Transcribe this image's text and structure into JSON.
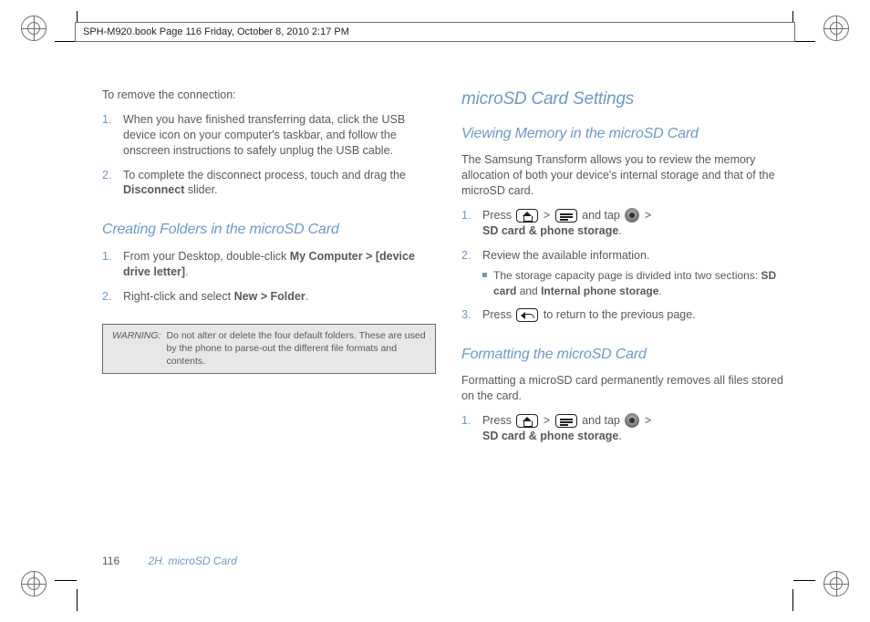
{
  "header": {
    "text": "SPH-M920.book  Page 116  Friday, October 8, 2010  2:17 PM"
  },
  "left": {
    "lead": "To remove the connection:",
    "remove_steps": [
      "When you have finished transferring data, click the USB device icon on your computer's taskbar, and follow the onscreen instructions to safely unplug the USB cable.",
      {
        "pre": "To complete the disconnect process, touch and drag the ",
        "ui": "Disconnect",
        "post": " slider."
      }
    ],
    "h2_folders": "Creating Folders in the microSD Card",
    "folder_steps": [
      {
        "pre": "From your Desktop, double-click ",
        "ui1": "My Computer",
        "gt": " > ",
        "ui2": "[device drive letter]",
        "post": "."
      },
      {
        "pre": "Right-click and select ",
        "ui1": "New",
        "gt": " > ",
        "ui2": "Folder",
        "post": "."
      }
    ],
    "warning": {
      "label": "WARNING:",
      "text": "Do not alter or delete the four default folders. These are used by the phone to parse-out the different file formats and contents."
    }
  },
  "right": {
    "h1": "microSD Card Settings",
    "h2_viewing": "Viewing Memory in the microSD Card",
    "viewing_lead": "The Samsung Transform allows you to review the memory allocation of both your device's internal storage and that of the microSD card.",
    "step1": {
      "pre": "Press ",
      "gt": " > ",
      "mid": " and tap ",
      "ui": "SD card & phone storage",
      "post": "."
    },
    "step2": {
      "text": "Review the available information.",
      "sub_pre": "The storage capacity page is divided into two sections: ",
      "sub_ui1": "SD card",
      "sub_and": " and ",
      "sub_ui2": "Internal phone storage",
      "sub_post": "."
    },
    "step3": {
      "pre": "Press ",
      "post": " to return to the previous page."
    },
    "h2_formatting": "Formatting the microSD Card",
    "formatting_lead": "Formatting a microSD card permanently removes all files stored on the card.",
    "fstep1": {
      "pre": "Press ",
      "gt": " > ",
      "mid": " and tap ",
      "ui": "SD card & phone storage",
      "post": "."
    }
  },
  "footer": {
    "page": "116",
    "section": "2H. microSD Card"
  }
}
